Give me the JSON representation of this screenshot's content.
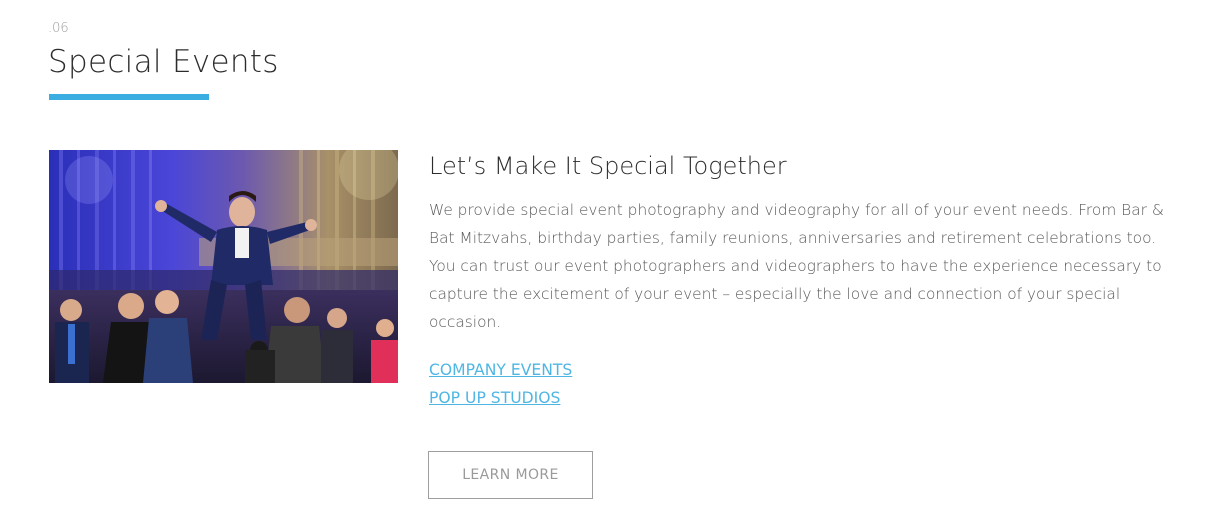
{
  "section": {
    "number": ".06",
    "title": "Special Events"
  },
  "content": {
    "heading": "Let’s Make It Special Together",
    "paragraph": "We provide special event photography and videography for all of your event needs. From Bar & Bat Mitzvahs, birthday parties, family reunions, anniversaries and retirement celebrations too. You can trust our event photographers and videographers to have the experience necessary to capture the excitement of your event – especially the love and connection of your special occasion.",
    "links": [
      {
        "label": "COMPANY EVENTS"
      },
      {
        "label": "POP UP STUDIOS"
      }
    ],
    "cta_label": "LEARN MORE"
  },
  "photo": {
    "icon": "event-photo"
  },
  "colors": {
    "accent": "#3aaee0",
    "link": "#4fb6e3",
    "title": "#2c2c2c",
    "body": "#5a5a5a"
  }
}
